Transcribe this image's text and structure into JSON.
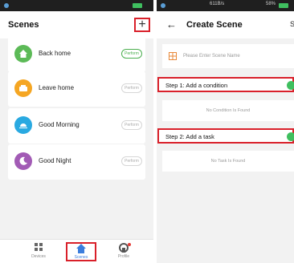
{
  "scenes_screen": {
    "title": "Scenes",
    "add_symbol": "+",
    "scenes": [
      {
        "name": "Back home",
        "perform": "Perform",
        "active": true,
        "color": "#5cba57"
      },
      {
        "name": "Leave home",
        "perform": "Perform",
        "active": false,
        "color": "#f5a623"
      },
      {
        "name": "Good Morning",
        "perform": "Perform",
        "active": false,
        "color": "#29a9e1"
      },
      {
        "name": "Good Night",
        "perform": "Perform",
        "active": false,
        "color": "#a25bb5"
      }
    ],
    "nav": [
      {
        "label": "Devices"
      },
      {
        "label": "Scenes"
      },
      {
        "label": "Profile"
      }
    ]
  },
  "create_scene_screen": {
    "status_text": "611B/s",
    "battery": "58%",
    "title": "Create Scene",
    "save": "Sa",
    "name_placeholder": "Please Enter Scene Name",
    "step1_label": "Step 1: Add a condition",
    "step1_empty": "No Condition Is Found",
    "step2_label": "Step 2: Add a task",
    "step2_empty": "No Task Is Found"
  },
  "colors": {
    "accent_green": "#4caf50",
    "highlight_red": "#d9202a",
    "nav_active": "#3b7ddd"
  }
}
